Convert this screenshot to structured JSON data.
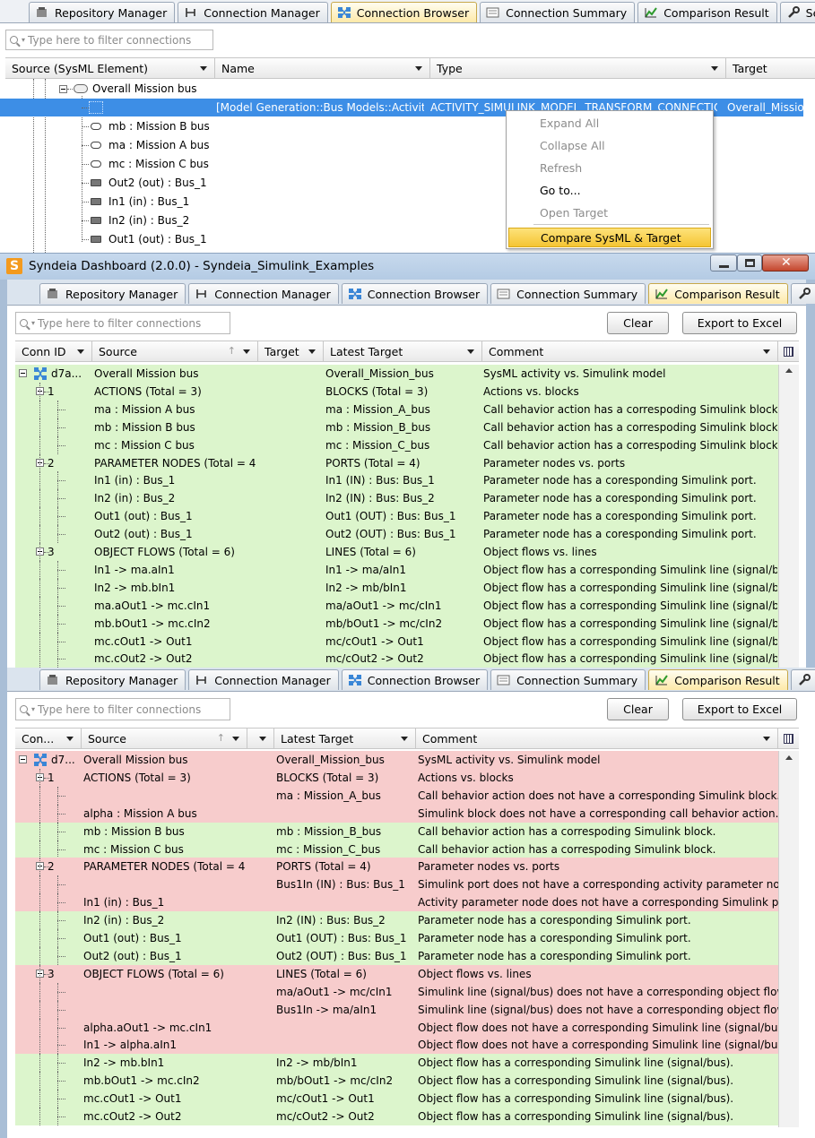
{
  "section1": {
    "tabs": [
      {
        "label": "Repository Manager",
        "icon": "repository-icon",
        "active": false
      },
      {
        "label": "Connection Manager",
        "icon": "connection-icon",
        "active": false
      },
      {
        "label": "Connection Browser",
        "icon": "browser-icon",
        "active": true
      },
      {
        "label": "Connection Summary",
        "icon": "summary-icon",
        "active": false
      },
      {
        "label": "Comparison Result",
        "icon": "comparison-icon",
        "active": false
      },
      {
        "label": "Settings",
        "icon": "wrench-icon",
        "active": false
      }
    ],
    "filter_placeholder": "Type here to filter connections",
    "columns": [
      "Source (SysML Element)",
      "Name",
      "Type",
      "Target"
    ],
    "tree": [
      {
        "source": "Overall Mission bus",
        "name": "",
        "type": "",
        "target": ""
      },
      {
        "source": "",
        "name": "[Model Generation::Bus Models::Activity:…",
        "type": "ACTIVITY_SIMULINK_MODEL_TRANSFORM_CONNECTION",
        "target": "Overall_Mission"
      },
      {
        "source": "mb : Mission B bus"
      },
      {
        "source": "ma : Mission A bus"
      },
      {
        "source": "mc : Mission C bus"
      },
      {
        "source": "Out2 (out) : Bus_1"
      },
      {
        "source": "In1 (in) : Bus_1"
      },
      {
        "source": "In2 (in) : Bus_2"
      },
      {
        "source": "Out1 (out) : Bus_1"
      }
    ],
    "context_menu": [
      {
        "label": "Expand All",
        "enabled": false
      },
      {
        "label": "Collapse All",
        "enabled": false
      },
      {
        "label": "Refresh",
        "enabled": false
      },
      {
        "label": "Go to...",
        "enabled": true
      },
      {
        "label": "Open Target",
        "enabled": false
      },
      {
        "label": "Compare SysML & Target",
        "enabled": true,
        "highlighted": true
      }
    ]
  },
  "window": {
    "title": "Syndeia Dashboard (2.0.0) - Syndeia_Simulink_Examples",
    "app_letter": "S"
  },
  "section2": {
    "tabs": [
      {
        "label": "Repository Manager",
        "icon": "repository-icon",
        "active": false
      },
      {
        "label": "Connection Manager",
        "icon": "connection-icon",
        "active": false
      },
      {
        "label": "Connection Browser",
        "icon": "browser-icon",
        "active": false
      },
      {
        "label": "Connection Summary",
        "icon": "summary-icon",
        "active": false
      },
      {
        "label": "Comparison Result",
        "icon": "comparison-icon",
        "active": true
      },
      {
        "label": "Settings",
        "icon": "wrench-icon",
        "active": false
      }
    ],
    "filter_placeholder": "Type here to filter connections",
    "clear_label": "Clear",
    "export_label": "Export to Excel",
    "columns": [
      "Conn ID",
      "Source",
      "Target",
      "Latest Target",
      "Comment"
    ],
    "rows": [
      {
        "lvl": 0,
        "id": "d7a...",
        "src": "Overall Mission bus",
        "tgt": "",
        "latest": "Overall_Mission_bus",
        "comment": "SysML activity vs. Simulink model",
        "status": "match"
      },
      {
        "lvl": 1,
        "id": "1",
        "src": "ACTIONS (Total = 3)",
        "tgt": "",
        "latest": "BLOCKS (Total = 3)",
        "comment": "Actions vs. blocks",
        "status": "match"
      },
      {
        "lvl": 2,
        "id": "",
        "src": "ma : Mission A bus",
        "tgt": "",
        "latest": "ma : Mission_A_bus",
        "comment": "Call behavior action has a correspoding Simulink block.",
        "status": "match"
      },
      {
        "lvl": 2,
        "id": "",
        "src": "mb : Mission B bus",
        "tgt": "",
        "latest": "mb : Mission_B_bus",
        "comment": "Call behavior action has a correspoding Simulink block.",
        "status": "match"
      },
      {
        "lvl": 2,
        "id": "",
        "src": "mc : Mission C bus",
        "tgt": "",
        "latest": "mc : Mission_C_bus",
        "comment": "Call behavior action has a correspoding Simulink block.",
        "status": "match"
      },
      {
        "lvl": 1,
        "id": "2",
        "src": "PARAMETER NODES (Total = 4)",
        "tgt": "",
        "latest": "PORTS (Total = 4)",
        "comment": "Parameter nodes vs. ports",
        "status": "match"
      },
      {
        "lvl": 2,
        "id": "",
        "src": "In1 (in) : Bus_1",
        "tgt": "",
        "latest": "In1 (IN) : Bus: Bus_1",
        "comment": "Parameter node has a coresponding Simulink port.",
        "status": "match"
      },
      {
        "lvl": 2,
        "id": "",
        "src": "In2 (in) : Bus_2",
        "tgt": "",
        "latest": "In2 (IN) : Bus: Bus_2",
        "comment": "Parameter node has a coresponding Simulink port.",
        "status": "match"
      },
      {
        "lvl": 2,
        "id": "",
        "src": "Out1 (out) : Bus_1",
        "tgt": "",
        "latest": "Out1 (OUT) : Bus: Bus_1",
        "comment": "Parameter node has a coresponding Simulink port.",
        "status": "match"
      },
      {
        "lvl": 2,
        "id": "",
        "src": "Out2 (out) : Bus_1",
        "tgt": "",
        "latest": "Out2 (OUT) : Bus: Bus_1",
        "comment": "Parameter node has a coresponding Simulink port.",
        "status": "match"
      },
      {
        "lvl": 1,
        "id": "3",
        "src": "OBJECT FLOWS (Total = 6)",
        "tgt": "",
        "latest": "LINES (Total = 6)",
        "comment": "Object flows vs. lines",
        "status": "match"
      },
      {
        "lvl": 2,
        "id": "",
        "src": "In1 -> ma.aIn1",
        "tgt": "",
        "latest": "In1 -> ma/aIn1",
        "comment": "Object flow has a corresponding Simulink line (signal/bus).",
        "status": "match"
      },
      {
        "lvl": 2,
        "id": "",
        "src": "In2 -> mb.bIn1",
        "tgt": "",
        "latest": "In2 -> mb/bIn1",
        "comment": "Object flow has a corresponding Simulink line (signal/bus).",
        "status": "match"
      },
      {
        "lvl": 2,
        "id": "",
        "src": "ma.aOut1 -> mc.cIn1",
        "tgt": "",
        "latest": "ma/aOut1 -> mc/cIn1",
        "comment": "Object flow has a corresponding Simulink line (signal/bus).",
        "status": "match"
      },
      {
        "lvl": 2,
        "id": "",
        "src": "mb.bOut1 -> mc.cIn2",
        "tgt": "",
        "latest": "mb/bOut1 -> mc/cIn2",
        "comment": "Object flow has a corresponding Simulink line (signal/bus).",
        "status": "match"
      },
      {
        "lvl": 2,
        "id": "",
        "src": "mc.cOut1 -> Out1",
        "tgt": "",
        "latest": "mc/cOut1 -> Out1",
        "comment": "Object flow has a corresponding Simulink line (signal/bus).",
        "status": "match"
      },
      {
        "lvl": 2,
        "id": "",
        "src": "mc.cOut2 -> Out2",
        "tgt": "",
        "latest": "mc/cOut2 -> Out2",
        "comment": "Object flow has a corresponding Simulink line (signal/bus).",
        "status": "match"
      }
    ]
  },
  "section3": {
    "tabs": [
      {
        "label": "Repository Manager",
        "icon": "repository-icon",
        "active": false
      },
      {
        "label": "Connection Manager",
        "icon": "connection-icon",
        "active": false
      },
      {
        "label": "Connection Browser",
        "icon": "browser-icon",
        "active": false
      },
      {
        "label": "Connection Summary",
        "icon": "summary-icon",
        "active": false
      },
      {
        "label": "Comparison Result",
        "icon": "comparison-icon",
        "active": true
      },
      {
        "label": "Settings",
        "icon": "wrench-icon",
        "active": false
      }
    ],
    "filter_placeholder": "Type here to filter connections",
    "clear_label": "Clear",
    "export_label": "Export to Excel",
    "columns": [
      "Con...",
      "Source",
      "",
      "Latest Target",
      "Comment"
    ],
    "rows": [
      {
        "lvl": 0,
        "id": "d7...",
        "src": "Overall Mission bus",
        "latest": "Overall_Mission_bus",
        "comment": "SysML activity vs. Simulink model",
        "status": "diff"
      },
      {
        "lvl": 1,
        "id": "1",
        "src": "ACTIONS (Total = 3)",
        "latest": "BLOCKS (Total = 3)",
        "comment": "Actions vs. blocks",
        "status": "diff"
      },
      {
        "lvl": 2,
        "id": "",
        "src": "",
        "latest": "ma : Mission_A_bus",
        "comment": "Call behavior action does not have a corresponding Simulink block.",
        "status": "diff"
      },
      {
        "lvl": 2,
        "id": "",
        "src": "alpha : Mission A bus",
        "latest": "",
        "comment": "Simulink block does not have a corresponding call behavior action.",
        "status": "diff"
      },
      {
        "lvl": 2,
        "id": "",
        "src": "mb : Mission B bus",
        "latest": "mb : Mission_B_bus",
        "comment": "Call behavior action has a correspoding Simulink block.",
        "status": "match"
      },
      {
        "lvl": 2,
        "id": "",
        "src": "mc : Mission C bus",
        "latest": "mc : Mission_C_bus",
        "comment": "Call behavior action has a correspoding Simulink block.",
        "status": "match"
      },
      {
        "lvl": 1,
        "id": "2",
        "src": "PARAMETER NODES (Total = 4)",
        "latest": "PORTS (Total = 4)",
        "comment": "Parameter nodes vs. ports",
        "status": "diff"
      },
      {
        "lvl": 2,
        "id": "",
        "src": "",
        "latest": "Bus1In (IN) : Bus: Bus_1",
        "comment": "Simulink port does not have a corresponding activity parameter node.",
        "status": "diff"
      },
      {
        "lvl": 2,
        "id": "",
        "src": "In1 (in) : Bus_1",
        "latest": "",
        "comment": "Activity parameter node does not have a corresponding Simulink port.",
        "status": "diff"
      },
      {
        "lvl": 2,
        "id": "",
        "src": "In2 (in) : Bus_2",
        "latest": "In2 (IN) : Bus: Bus_2",
        "comment": "Parameter node has a coresponding Simulink port.",
        "status": "match"
      },
      {
        "lvl": 2,
        "id": "",
        "src": "Out1 (out) : Bus_1",
        "latest": "Out1 (OUT) : Bus: Bus_1",
        "comment": "Parameter node has a coresponding Simulink port.",
        "status": "match"
      },
      {
        "lvl": 2,
        "id": "",
        "src": "Out2 (out) : Bus_1",
        "latest": "Out2 (OUT) : Bus: Bus_1",
        "comment": "Parameter node has a coresponding Simulink port.",
        "status": "match"
      },
      {
        "lvl": 1,
        "id": "3",
        "src": "OBJECT FLOWS (Total = 6)",
        "latest": "LINES (Total = 6)",
        "comment": "Object flows vs. lines",
        "status": "diff"
      },
      {
        "lvl": 2,
        "id": "",
        "src": "",
        "latest": "ma/aOut1 -> mc/cIn1",
        "comment": "Simulink line (signal/bus) does not have a corresponding object flow.",
        "status": "diff"
      },
      {
        "lvl": 2,
        "id": "",
        "src": "",
        "latest": "Bus1In -> ma/aIn1",
        "comment": "Simulink line (signal/bus) does not have a corresponding object flow.",
        "status": "diff"
      },
      {
        "lvl": 2,
        "id": "",
        "src": "alpha.aOut1 -> mc.cIn1",
        "latest": "",
        "comment": "Object flow does not have a corresponding Simulink line (signal/bus).",
        "status": "diff"
      },
      {
        "lvl": 2,
        "id": "",
        "src": "In1 -> alpha.aIn1",
        "latest": "",
        "comment": "Object flow does not have a corresponding Simulink line (signal/bus).",
        "status": "diff"
      },
      {
        "lvl": 2,
        "id": "",
        "src": "In2 -> mb.bIn1",
        "latest": "In2 -> mb/bIn1",
        "comment": "Object flow has a corresponding Simulink line (signal/bus).",
        "status": "match"
      },
      {
        "lvl": 2,
        "id": "",
        "src": "mb.bOut1 -> mc.cIn2",
        "latest": "mb/bOut1 -> mc/cIn2",
        "comment": "Object flow has a corresponding Simulink line (signal/bus).",
        "status": "match"
      },
      {
        "lvl": 2,
        "id": "",
        "src": "mc.cOut1 -> Out1",
        "latest": "mc/cOut1 -> Out1",
        "comment": "Object flow has a corresponding Simulink line (signal/bus).",
        "status": "match"
      },
      {
        "lvl": 2,
        "id": "",
        "src": "mc.cOut2 -> Out2",
        "latest": "mc/cOut2 -> Out2",
        "comment": "Object flow has a corresponding Simulink line (signal/bus).",
        "status": "match"
      }
    ]
  },
  "colors": {
    "match_row": "#dcf5cc",
    "diff_row": "#f7cccc",
    "selected_row": "#3d8ee6",
    "menu_highlight": "#f9d24b",
    "active_tab": "#fde9a8"
  }
}
